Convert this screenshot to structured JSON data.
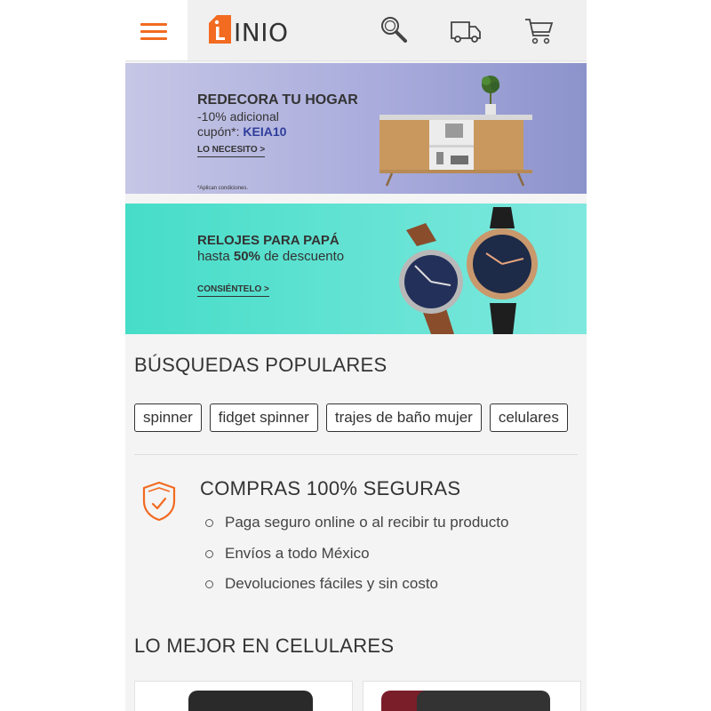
{
  "header": {
    "brand": "INIO",
    "icons": [
      "menu-icon",
      "search-icon",
      "truck-icon",
      "cart-icon"
    ],
    "accent_color": "#f26b21"
  },
  "banners": [
    {
      "title": "REDECORA TU HOGAR",
      "line1": "-10% adicional",
      "line2_prefix": "cupón*: ",
      "coupon": "KEIA10",
      "cta": "LO NECESITO >",
      "note": "*Aplican condiciones."
    },
    {
      "title": "RELOJES PARA PAPÁ",
      "line_prefix": "hasta ",
      "line_highlight": "50%",
      "line_suffix": " de descuento",
      "cta": "CONSIÉNTELO >"
    }
  ],
  "popular": {
    "title": "BÚSQUEDAS POPULARES",
    "chips": [
      "spinner",
      "fidget spinner",
      "trajes de baño mujer",
      "celulares"
    ]
  },
  "secure": {
    "title": "COMPRAS 100% SEGURAS",
    "items": [
      "Paga seguro online o al recibir tu producto",
      "Envíos a todo México",
      "Devoluciones fáciles y sin costo"
    ]
  },
  "best": {
    "title": "LO MEJOR EN CELULARES"
  }
}
